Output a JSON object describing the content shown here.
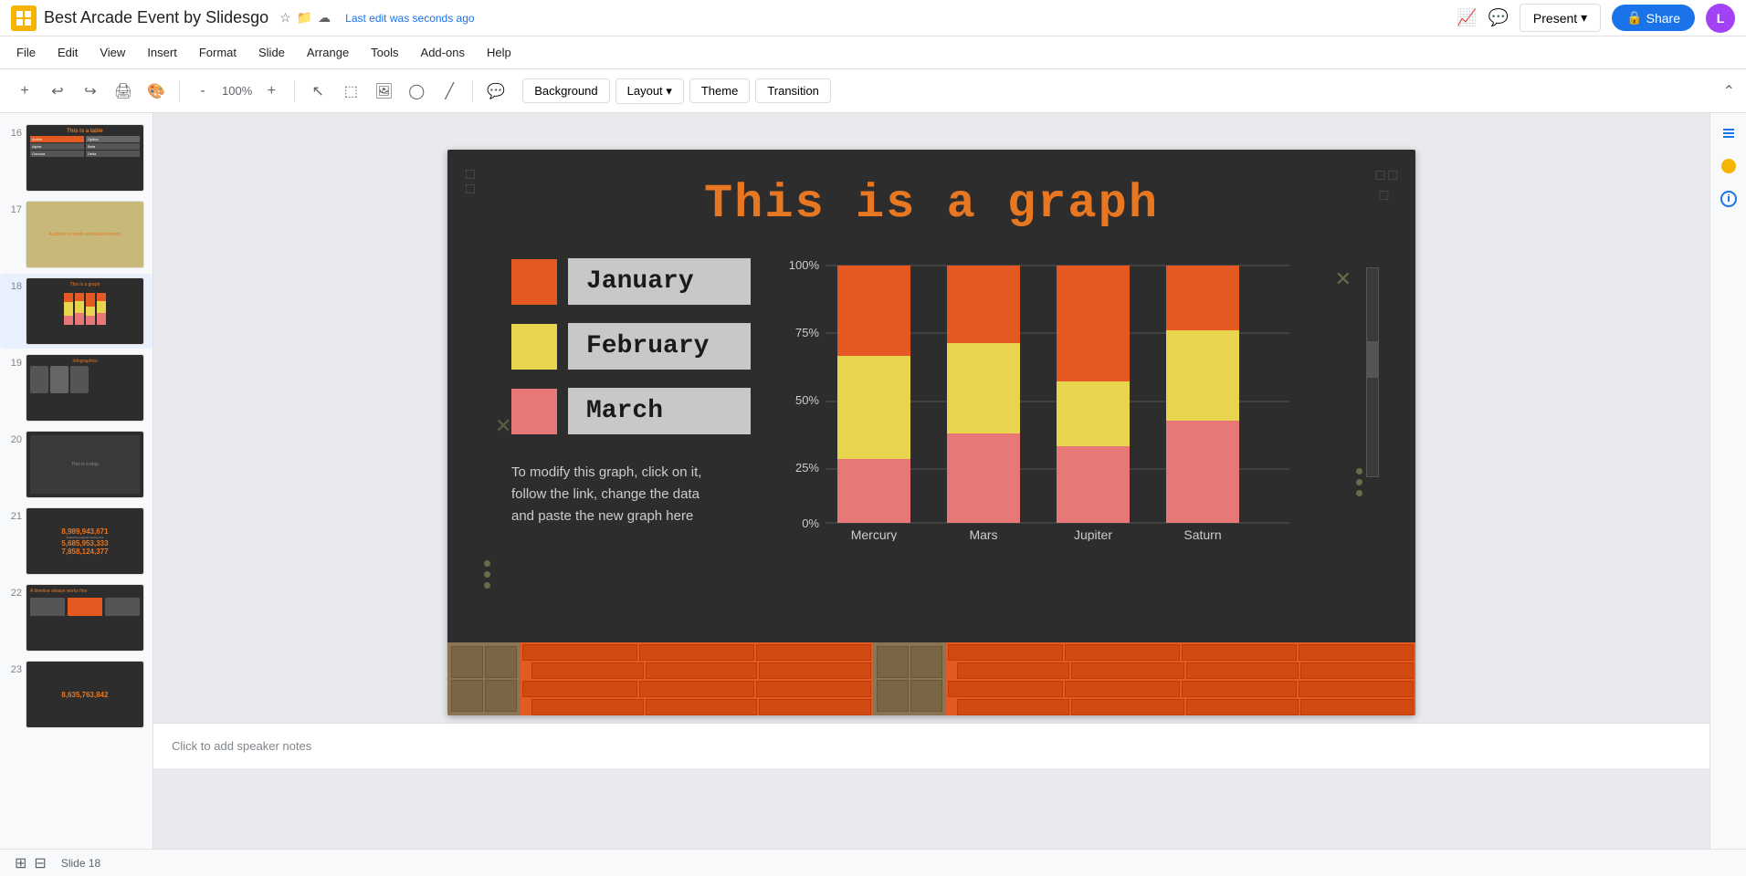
{
  "app": {
    "logo": "📊",
    "title": "Best Arcade Event by Slidesgo",
    "last_edit": "Last edit was seconds ago"
  },
  "menus": {
    "items": [
      "File",
      "Edit",
      "View",
      "Insert",
      "Format",
      "Slide",
      "Arrange",
      "Tools",
      "Add-ons",
      "Help"
    ]
  },
  "toolbar": {
    "background_label": "Background",
    "layout_label": "Layout",
    "theme_label": "Theme",
    "transition_label": "Transition"
  },
  "header_buttons": {
    "present_label": "Present",
    "share_label": "Share",
    "avatar_initials": "L"
  },
  "slide_panel": {
    "slides": [
      {
        "num": "16",
        "type": "table"
      },
      {
        "num": "17",
        "type": "image"
      },
      {
        "num": "18",
        "type": "graph",
        "active": true
      },
      {
        "num": "19",
        "type": "infographic"
      },
      {
        "num": "20",
        "type": "map"
      },
      {
        "num": "21",
        "type": "numbers"
      },
      {
        "num": "22",
        "type": "timeline"
      },
      {
        "num": "23",
        "type": "numbers2"
      }
    ]
  },
  "slide": {
    "title": "This is a graph",
    "legend": {
      "items": [
        {
          "color": "#e55a22",
          "label": "January"
        },
        {
          "color": "#e8d44d",
          "label": "February"
        },
        {
          "color": "#e87878",
          "label": "March"
        }
      ]
    },
    "description": "To modify this graph, click on it,\nfollow the link, change the data\nand paste the new graph here",
    "chart": {
      "y_labels": [
        "100%",
        "75%",
        "50%",
        "25%",
        "0%"
      ],
      "bars": [
        {
          "label": "Mercury",
          "segments": [
            {
              "color": "#e55a22",
              "pct": 35
            },
            {
              "color": "#e8d44d",
              "pct": 40
            },
            {
              "color": "#e87878",
              "pct": 25
            }
          ]
        },
        {
          "label": "Mars",
          "segments": [
            {
              "color": "#e55a22",
              "pct": 30
            },
            {
              "color": "#e8d44d",
              "pct": 35
            },
            {
              "color": "#e87878",
              "pct": 35
            }
          ]
        },
        {
          "label": "Jupiter",
          "segments": [
            {
              "color": "#e55a22",
              "pct": 45
            },
            {
              "color": "#e8d44d",
              "pct": 25
            },
            {
              "color": "#e87878",
              "pct": 30
            }
          ]
        },
        {
          "label": "Saturn",
          "segments": [
            {
              "color": "#e55a22",
              "pct": 25
            },
            {
              "color": "#e8d44d",
              "pct": 35
            },
            {
              "color": "#e87878",
              "pct": 40
            }
          ]
        }
      ]
    }
  },
  "notes": {
    "placeholder": "Click to add speaker notes"
  },
  "slide_numbers": {
    "s21_num1": "8,989,943,671",
    "s21_num2": "5,685,953,333",
    "s21_num3": "7,858,124,377",
    "s23_num": "8,635,763,842"
  }
}
